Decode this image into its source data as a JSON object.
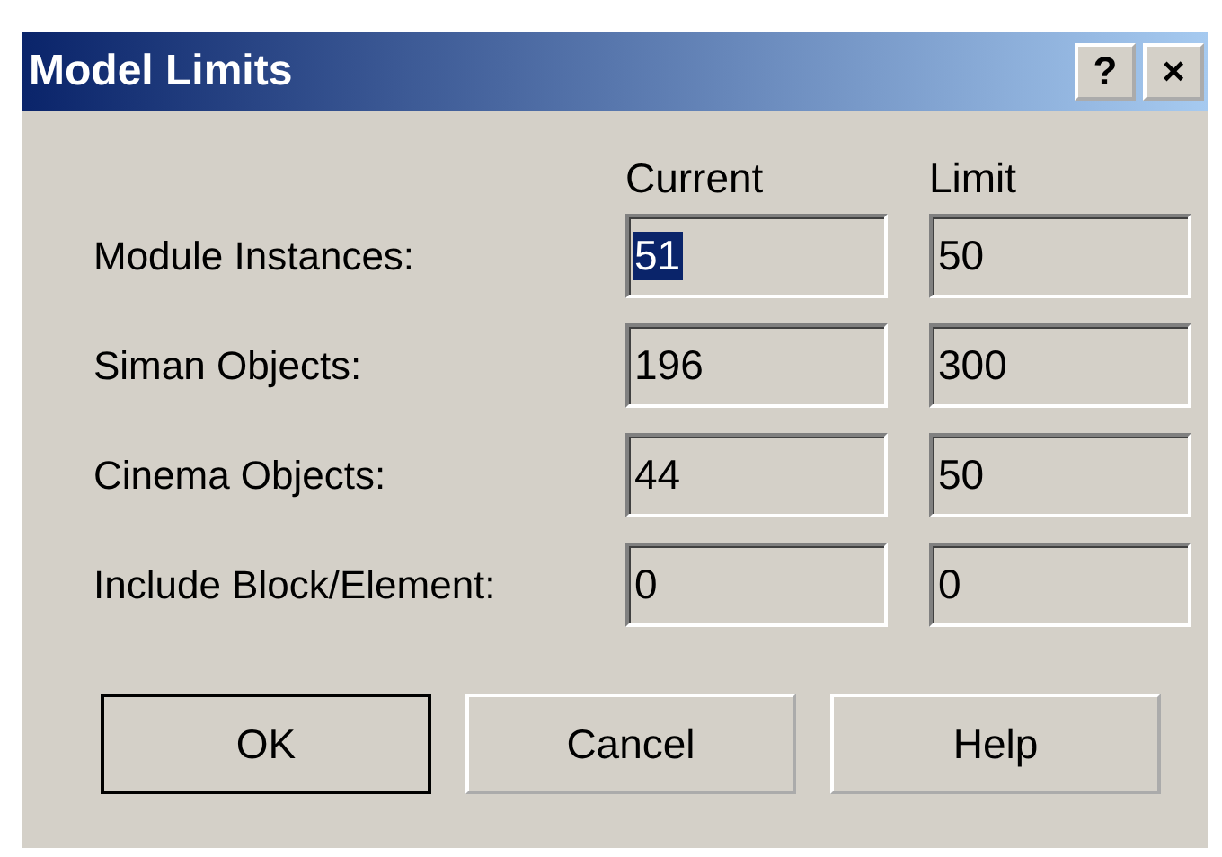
{
  "window": {
    "title": "Model Limits",
    "title_buttons": [
      "?",
      "×"
    ]
  },
  "columns": [
    "Current",
    "Limit"
  ],
  "rows": [
    {
      "label": "Module Instances:",
      "current": {
        "value": "51",
        "selected": true
      },
      "limit": {
        "value": "50",
        "selected": false
      }
    },
    {
      "label": "Siman Objects:",
      "current": {
        "value": "196",
        "selected": false
      },
      "limit": {
        "value": "300",
        "selected": false
      }
    },
    {
      "label": "Cinema Objects:",
      "current": {
        "value": "44",
        "selected": false
      },
      "limit": {
        "value": "50",
        "selected": false
      }
    },
    {
      "label": "Include Block/Element:",
      "current": {
        "value": "0",
        "selected": false
      },
      "limit": {
        "value": "0",
        "selected": false
      }
    }
  ],
  "buttons": [
    {
      "label": "OK",
      "default": true
    },
    {
      "label": "Cancel",
      "default": false
    },
    {
      "label": "Help",
      "default": false
    }
  ]
}
